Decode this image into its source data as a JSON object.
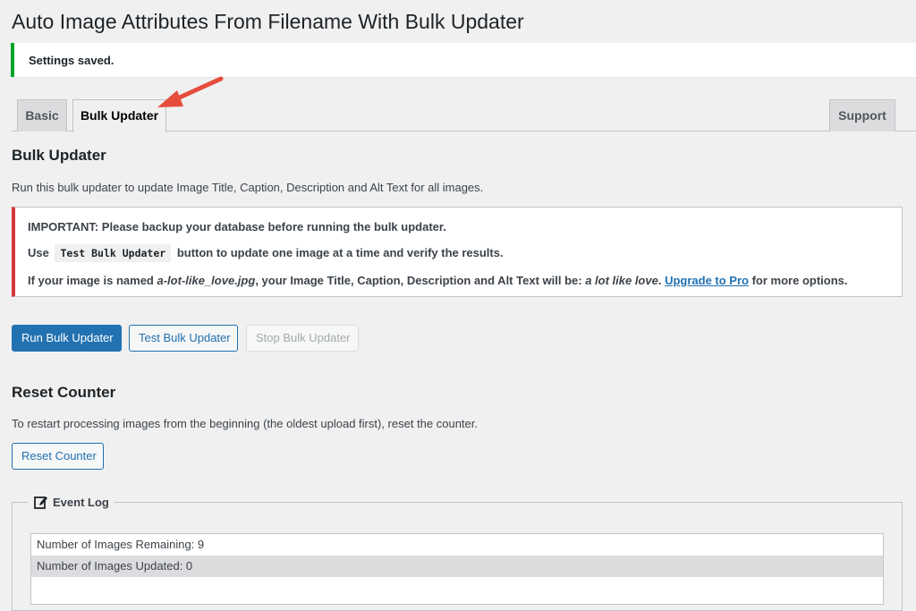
{
  "page": {
    "title": "Auto Image Attributes From Filename With Bulk Updater"
  },
  "notice": {
    "text": "Settings saved."
  },
  "tabs": [
    {
      "label": "Basic"
    },
    {
      "label": "Bulk Updater"
    },
    {
      "label": "Support"
    }
  ],
  "bulk": {
    "heading": "Bulk Updater",
    "description": "Run this bulk updater to update Image Title, Caption, Description and Alt Text for all images.",
    "important": {
      "line1": "IMPORTANT: Please backup your database before running the bulk updater.",
      "line2_pre": "Use",
      "line2_code": "Test Bulk Updater",
      "line2_post": "button to update one image at a time and verify the results.",
      "line3_pre": "If your image is named ",
      "line3_filename": "a-lot-like_love.jpg",
      "line3_mid": ", your Image Title, Caption, Description and Alt Text will be: ",
      "line3_result": "a lot like love",
      "line3_dot": ". ",
      "line3_link": "Upgrade to Pro",
      "line3_post": " for more options."
    },
    "buttons": {
      "run": "Run Bulk Updater",
      "test": "Test Bulk Updater",
      "stop": "Stop Bulk Updater"
    }
  },
  "reset": {
    "heading": "Reset Counter",
    "description": "To restart processing images from the beginning (the oldest upload first), reset the counter.",
    "button": "Reset Counter"
  },
  "event_log": {
    "legend": "Event Log",
    "rows": [
      "Number of Images Remaining: 9",
      "Number of Images Updated: 0"
    ]
  },
  "colors": {
    "primary": "#2271b1",
    "success": "#00a32a",
    "error": "#d63638",
    "annotation_arrow": "#e74c3c"
  },
  "icons": {
    "legend": "edit-icon",
    "annotation": "arrow-annotation-icon"
  }
}
